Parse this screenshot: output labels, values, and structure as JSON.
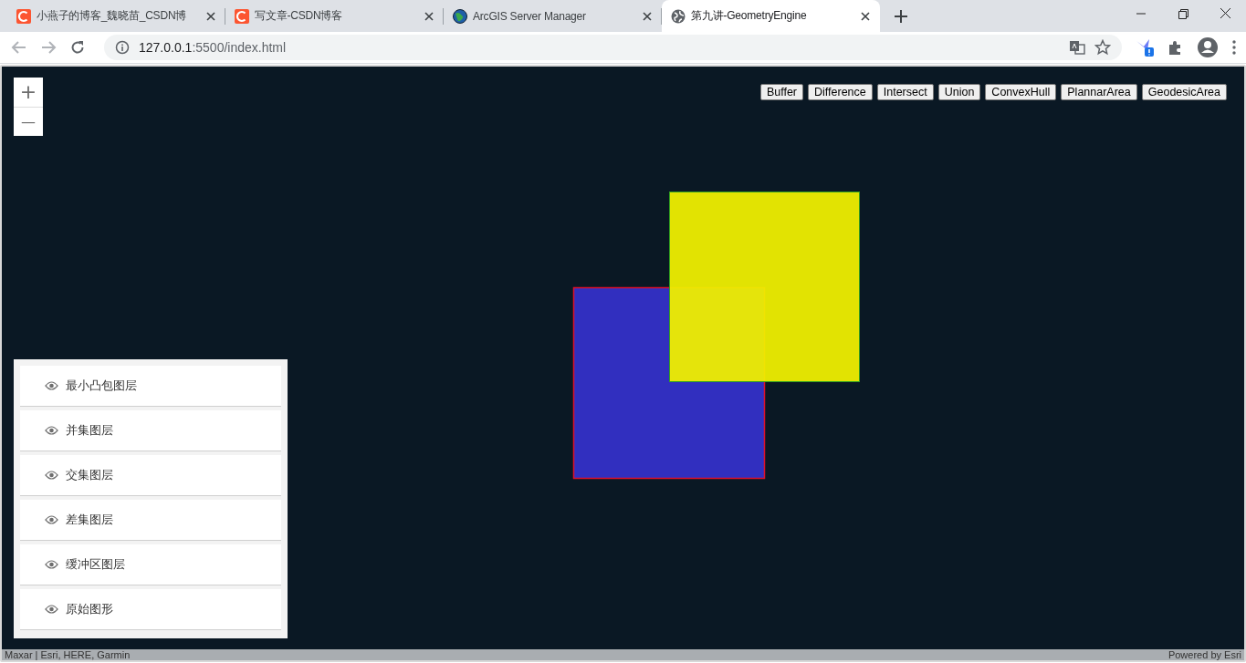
{
  "tabs": [
    {
      "title": "小燕子的博客_魏晓苗_CSDN博",
      "kind": "csdn",
      "selected": false
    },
    {
      "title": "写文章-CSDN博客",
      "kind": "csdn",
      "selected": false
    },
    {
      "title": "ArcGIS Server Manager",
      "kind": "arcgis",
      "selected": false
    },
    {
      "title": "第九讲-GeometryEngine",
      "kind": "globe",
      "selected": true
    }
  ],
  "address": {
    "host": "127.0.0.1",
    "path": ":5500/index.html"
  },
  "map": {
    "zoom_in": "+",
    "zoom_out": "—",
    "buttons": [
      "Buffer",
      "Difference",
      "Intersect",
      "Union",
      "ConvexHull",
      "PlannarArea",
      "GeodesicArea"
    ],
    "layer_list": [
      {
        "title": "最小凸包图层"
      },
      {
        "title": "并集图层"
      },
      {
        "title": "交集图层"
      },
      {
        "title": "差集图层"
      },
      {
        "title": "缓冲区图层"
      },
      {
        "title": "原始图形"
      }
    ],
    "attribution": "Maxar | Esri, HERE, Garmin",
    "powered_by": "Powered by Esri"
  }
}
